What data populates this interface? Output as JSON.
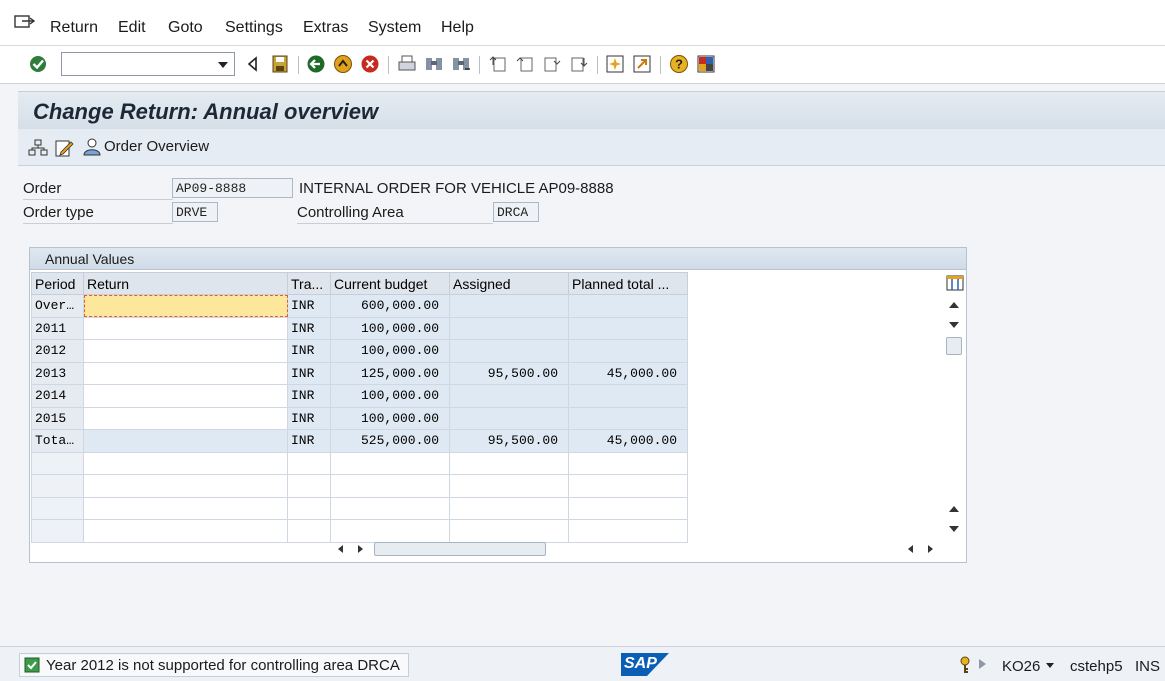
{
  "menu": {
    "items": [
      "Return",
      "Edit",
      "Goto",
      "Settings",
      "Extras",
      "System",
      "Help"
    ]
  },
  "toolbar": {
    "command_value": ""
  },
  "title": "Change Return: Annual overview",
  "app_toolbar": {
    "order_overview_label": "Order Overview"
  },
  "header": {
    "order_label": "Order",
    "order_value": "AP09-8888",
    "order_desc": "INTERNAL ORDER FOR VEHICLE AP09-8888",
    "order_type_label": "Order type",
    "order_type_value": "DRVE",
    "controlling_area_label": "Controlling Area",
    "controlling_area_value": "DRCA"
  },
  "table": {
    "title": "Annual Values",
    "columns": [
      "Period",
      "Return",
      "Tra...",
      "Current budget",
      "Assigned",
      "Planned total ..."
    ],
    "rows": [
      {
        "period": "Over…",
        "return": "",
        "tra": "INR",
        "budget": "600,000.00",
        "assigned": "",
        "planned": ""
      },
      {
        "period": "2011",
        "return": "",
        "tra": "INR",
        "budget": "100,000.00",
        "assigned": "",
        "planned": ""
      },
      {
        "period": "2012",
        "return": "",
        "tra": "INR",
        "budget": "100,000.00",
        "assigned": "",
        "planned": ""
      },
      {
        "period": "2013",
        "return": "",
        "tra": "INR",
        "budget": "125,000.00",
        "assigned": "95,500.00",
        "planned": "45,000.00"
      },
      {
        "period": "2014",
        "return": "",
        "tra": "INR",
        "budget": "100,000.00",
        "assigned": "",
        "planned": ""
      },
      {
        "period": "2015",
        "return": "",
        "tra": "INR",
        "budget": "100,000.00",
        "assigned": "",
        "planned": ""
      },
      {
        "period": "Tota…",
        "return": "",
        "tra": "INR",
        "budget": "525,000.00",
        "assigned": "95,500.00",
        "planned": "45,000.00"
      }
    ]
  },
  "status": {
    "message": "Year 2012 is not supported for controlling area DRCA",
    "logo": "SAP",
    "transaction": "KO26",
    "server": "cstehp5",
    "mode": "INS"
  },
  "colors": {
    "title_bg": "#d6dfe8",
    "selected_cell": "#fde79b",
    "readonly_cell": "#dfe9f3",
    "sap_blue": "#0a5fb4"
  },
  "icons": {
    "toolbar": [
      "enter-check-icon",
      "back-triangle-icon",
      "save-icon",
      "back-green-icon",
      "exit-icon",
      "cancel-icon",
      "print-icon",
      "find-icon",
      "find-next-icon",
      "first-page-icon",
      "prev-page-icon",
      "next-page-icon",
      "last-page-icon",
      "create-session-icon",
      "shortcut-icon",
      "help-icon",
      "layout-icon"
    ],
    "app_toolbar": [
      "hierarchy-icon",
      "edit-icon",
      "person-icon"
    ]
  }
}
